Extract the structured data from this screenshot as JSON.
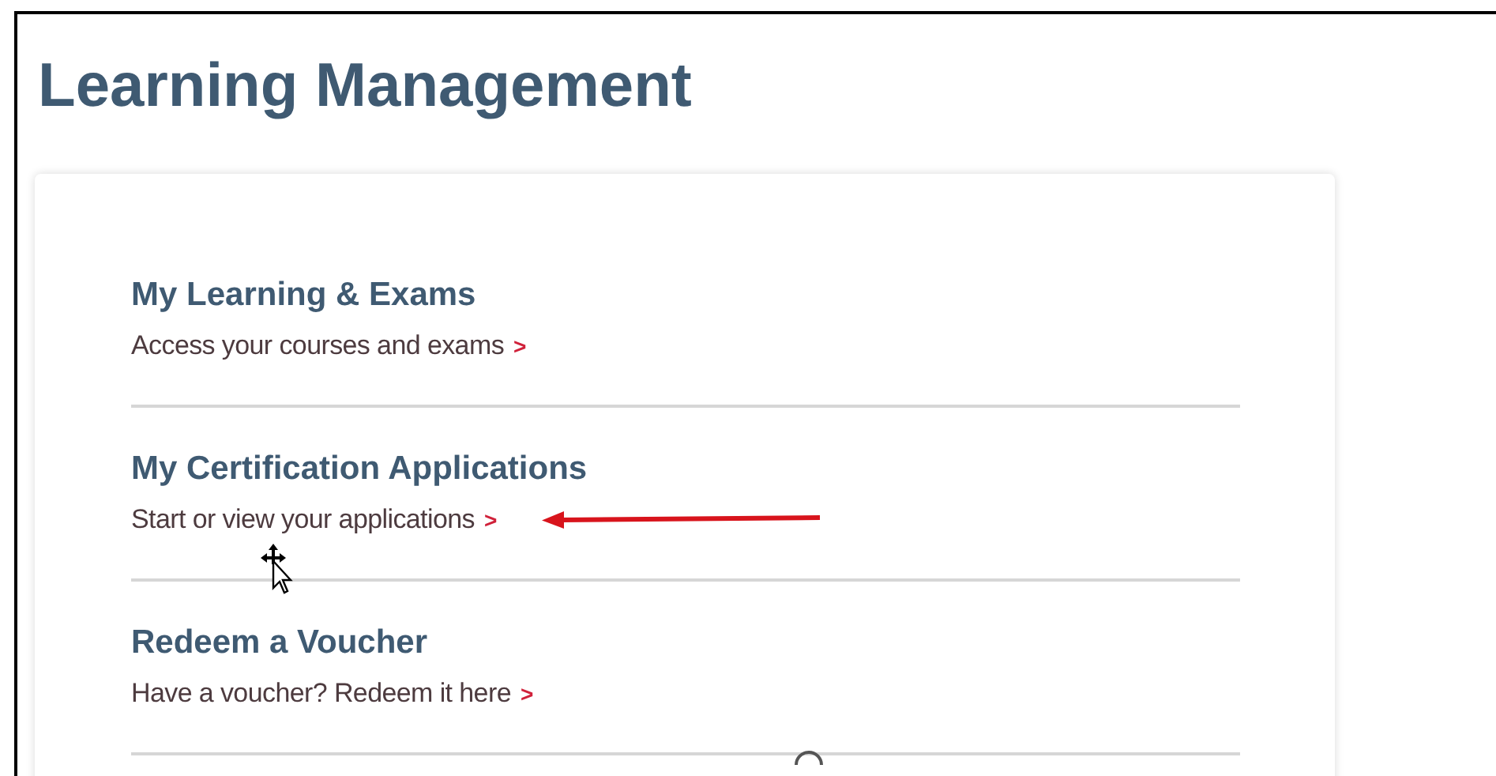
{
  "page": {
    "title": "Learning Management"
  },
  "items": [
    {
      "heading": "My Learning & Exams",
      "link": "Access your courses and exams",
      "chevron": ">",
      "annotated": false
    },
    {
      "heading": "My Certification Applications",
      "link": "Start or view your applications",
      "chevron": ">",
      "annotated": true
    },
    {
      "heading": "Redeem a Voucher",
      "link": "Have a voucher? Redeem it here",
      "chevron": ">",
      "annotated": false
    }
  ]
}
